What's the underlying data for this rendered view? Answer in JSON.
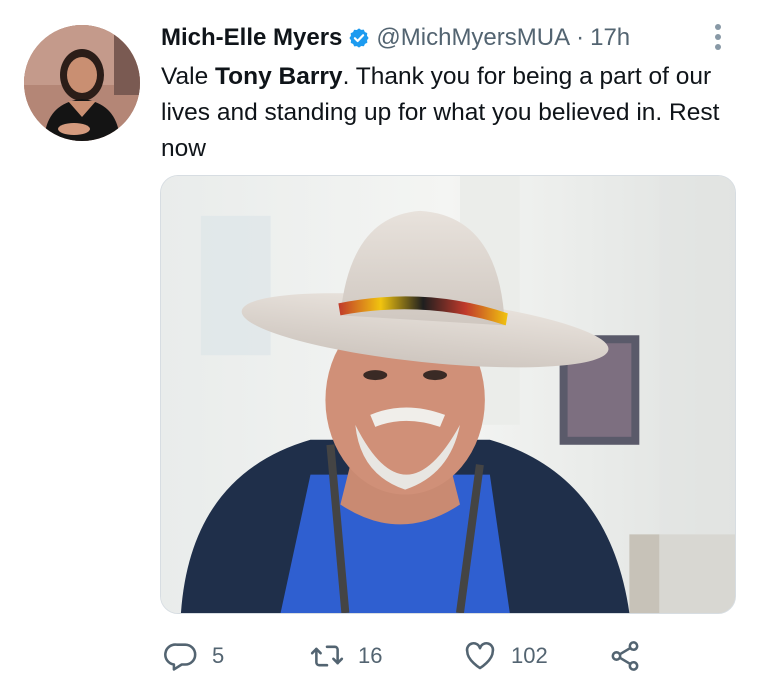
{
  "tweet": {
    "display_name": "Mich-Elle Myers",
    "handle": "@MichMyersMUA",
    "separator": "·",
    "time": "17h",
    "text_prefix": "Vale ",
    "text_bold": "Tony Barry",
    "text_suffix": ". Thank you for being a part of our lives and standing up for what you believed in. Rest now"
  },
  "actions": {
    "replies": "5",
    "retweets": "16",
    "likes": "102"
  },
  "icons": {
    "verified": "verified-badge-icon",
    "more": "more-options-icon",
    "reply": "reply-icon",
    "retweet": "retweet-icon",
    "like": "heart-icon",
    "share": "share-icon"
  },
  "colors": {
    "verified_blue": "#1d9bf0",
    "secondary_text": "#536471",
    "primary_text": "#0f1419"
  }
}
